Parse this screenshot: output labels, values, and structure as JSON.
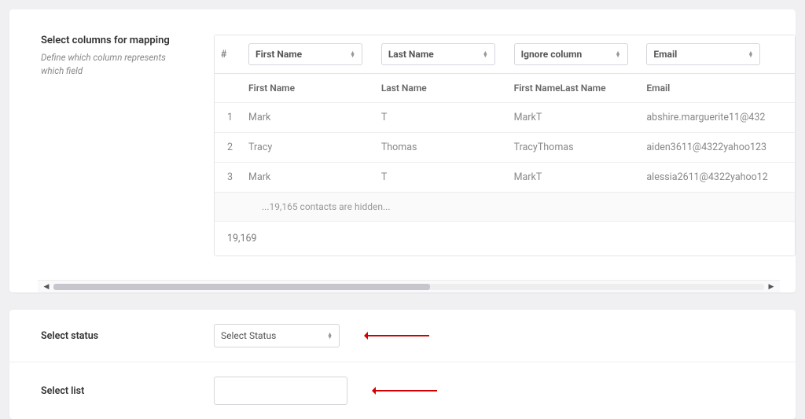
{
  "mapping": {
    "title": "Select columns for mapping",
    "subtitle": "Define which column represents which field",
    "index_header": "#",
    "column_selects": [
      {
        "value": "First Name"
      },
      {
        "value": "Last Name"
      },
      {
        "value": "Ignore column"
      },
      {
        "value": "Email"
      }
    ],
    "headers": [
      "First Name",
      "Last Name",
      "First NameLast Name",
      "Email"
    ],
    "rows": [
      {
        "idx": "1",
        "cells": [
          "Mark",
          "T",
          "MarkT",
          "abshire.marguerite11@432"
        ]
      },
      {
        "idx": "2",
        "cells": [
          "Tracy",
          "Thomas",
          "TracyThomas",
          "aiden3611@4322yahoo123"
        ]
      },
      {
        "idx": "3",
        "cells": [
          "Mark",
          "T",
          "MarkT",
          "alessia2611@4322yahoo12"
        ]
      }
    ],
    "hidden_text": "...19,165 contacts are hidden...",
    "total": "19,169"
  },
  "status": {
    "label": "Select status",
    "select_placeholder": "Select Status"
  },
  "list": {
    "label": "Select list",
    "value": ""
  }
}
